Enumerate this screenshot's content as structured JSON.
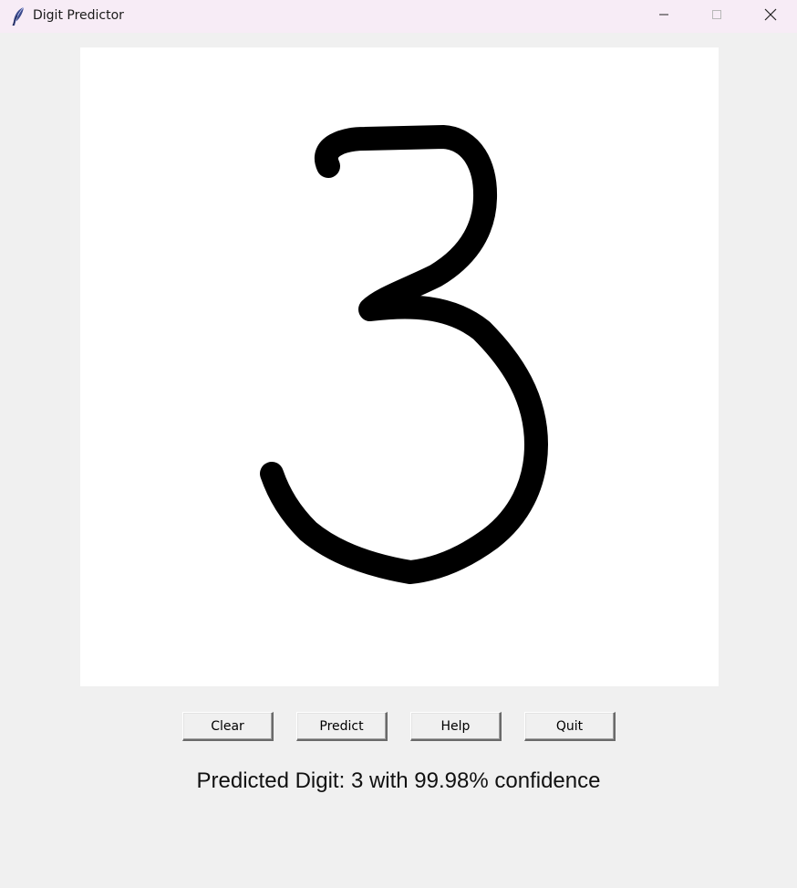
{
  "window": {
    "title": "Digit Predictor",
    "icon": "feather-icon",
    "controls": {
      "minimize": "minimize-icon",
      "maximize": "maximize-icon",
      "close": "close-icon"
    }
  },
  "canvas": {
    "background": "#ffffff",
    "stroke_color": "#000000",
    "drawn_content": "handwritten digit 3"
  },
  "buttons": {
    "clear": "Clear",
    "predict": "Predict",
    "help": "Help",
    "quit": "Quit"
  },
  "result": {
    "text": "Predicted Digit: 3 with 99.98% confidence",
    "digit": 3,
    "confidence_percent": 99.98
  },
  "colors": {
    "titlebar": "#f7ecf6",
    "window_bg": "#f0f0f0"
  }
}
